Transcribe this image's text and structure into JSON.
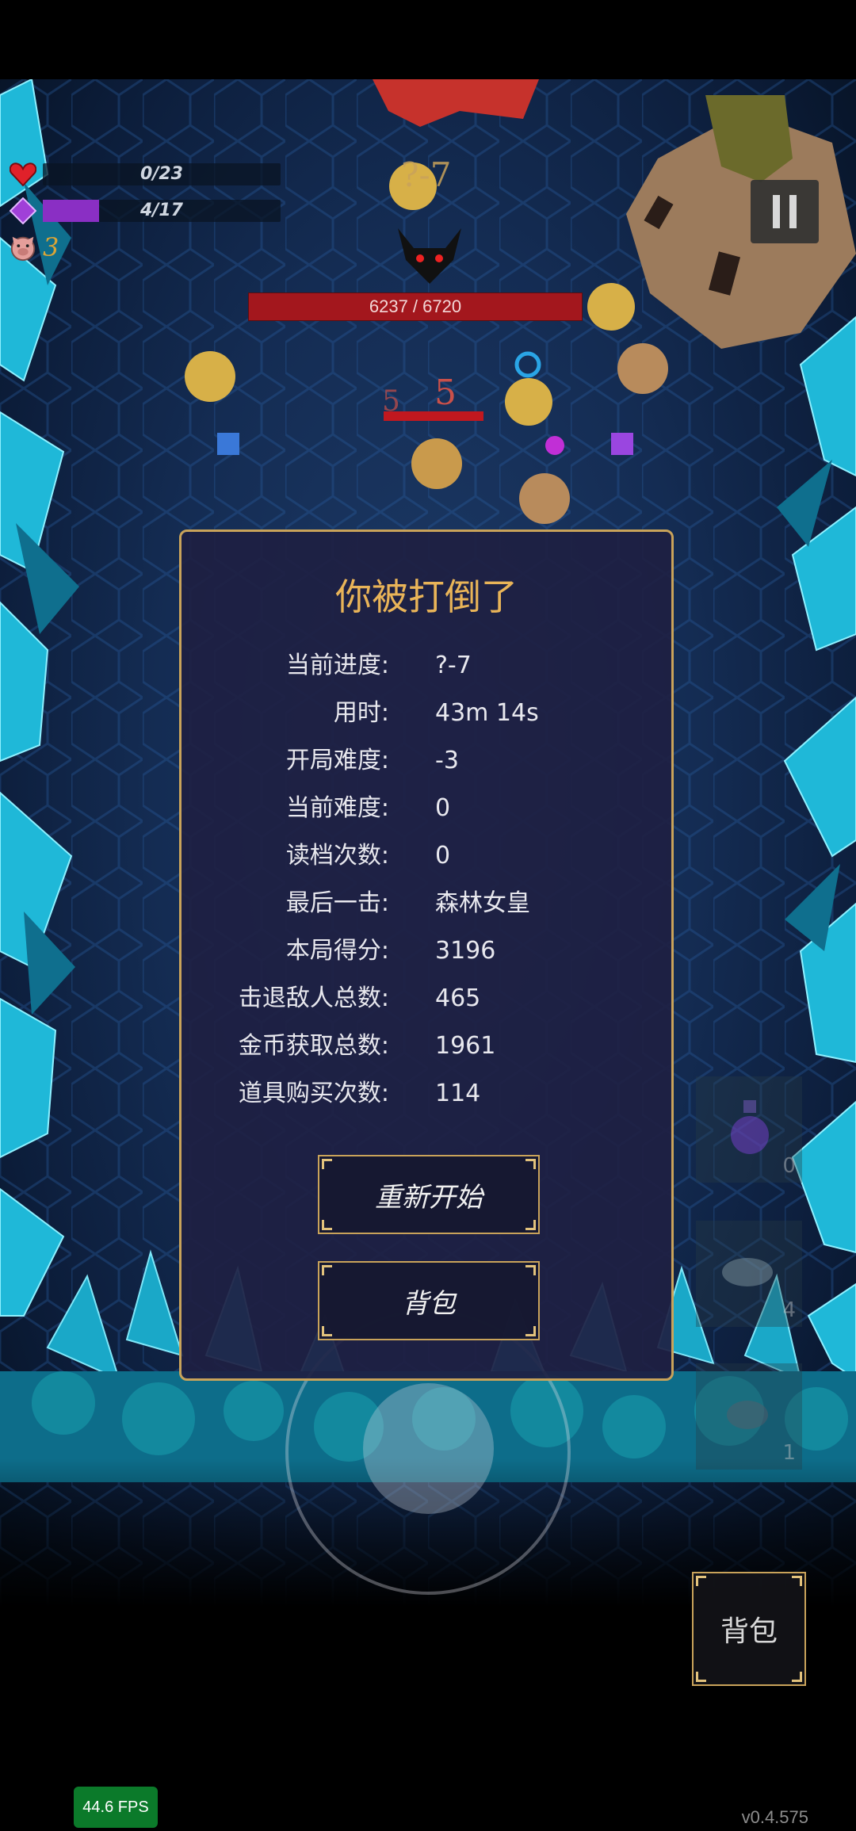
{
  "hud": {
    "health_text": "0/23",
    "health_value": 0,
    "health_max": 23,
    "mana_text": "4/17",
    "mana_value": 4,
    "mana_max": 17,
    "pig_count": "3"
  },
  "stage_label": "?-7",
  "boss": {
    "hp_text": "6237 / 6720",
    "hp": 6237,
    "hp_max": 6720
  },
  "damage_numbers": [
    "5",
    "5"
  ],
  "dialog": {
    "title": "你被打倒了",
    "stats": [
      {
        "label": "当前进度:",
        "value": "?-7"
      },
      {
        "label": "用时:",
        "value": "43m 14s"
      },
      {
        "label": "开局难度:",
        "value": "-3"
      },
      {
        "label": "当前难度:",
        "value": "0"
      },
      {
        "label": "读档次数:",
        "value": "0"
      },
      {
        "label": "最后一击:",
        "value": "森林女皇"
      },
      {
        "label": "本局得分:",
        "value": "3196"
      },
      {
        "label": "击退敌人总数:",
        "value": "465"
      },
      {
        "label": "金币获取总数:",
        "value": "1961"
      },
      {
        "label": "道具购买次数:",
        "value": "114"
      }
    ],
    "restart_label": "重新开始",
    "backpack_label": "背包"
  },
  "item_slots": [
    {
      "count": "0"
    },
    {
      "count": "4"
    },
    {
      "count": "1"
    }
  ],
  "bag_button_label": "背包",
  "fps": "44.6 FPS",
  "version": "v0.4.575",
  "colors": {
    "gold": "#c9a35a",
    "title": "#e9b458",
    "health": "#a3171d",
    "mana": "#8a2fc4",
    "dialog_bg": "#1e2042"
  }
}
